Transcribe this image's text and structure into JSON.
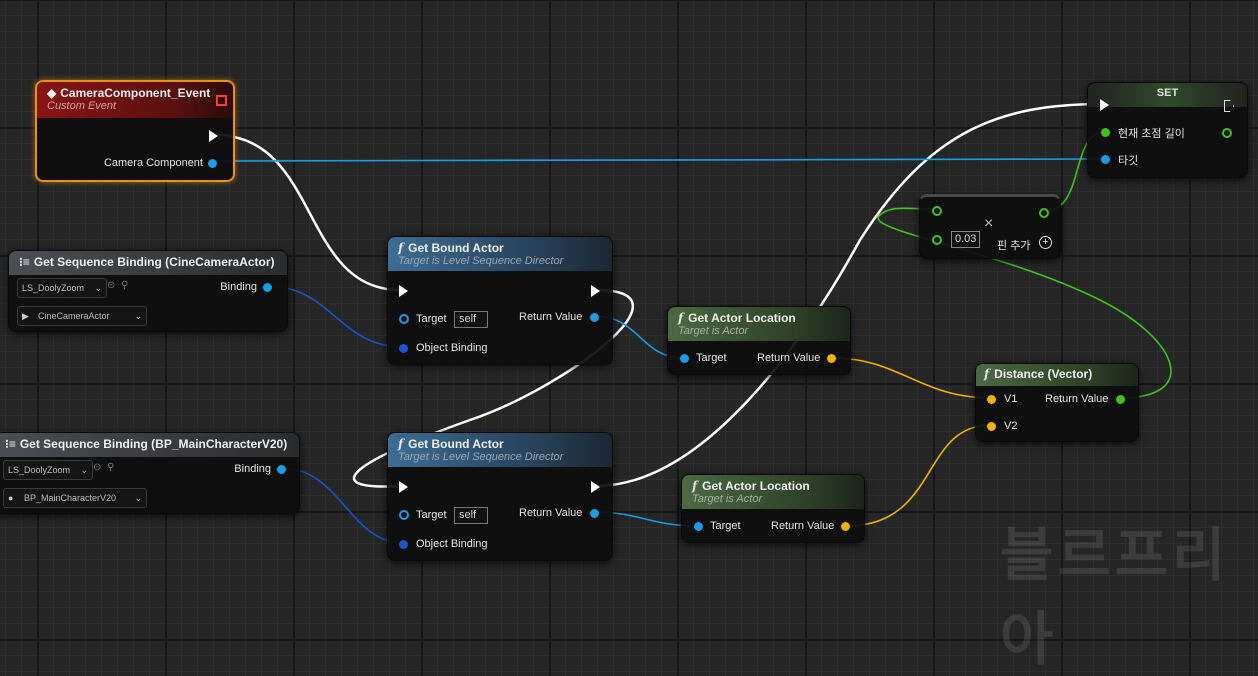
{
  "watermark": "블르프리아",
  "event_node": {
    "title": "CameraComponent_Event",
    "subtitle": "Custom Event",
    "pin_label": "Camera Component"
  },
  "binding_1": {
    "title": "Get Sequence Binding (CineCameraActor)",
    "sequence": "LS_DoolyZoom",
    "actor": "CineCameraActor",
    "pin_label": "Binding"
  },
  "binding_2": {
    "title": "Get Sequence Binding (BP_MainCharacterV20)",
    "sequence": "LS_DoolyZoom",
    "actor": "BP_MainCharacterV20",
    "pin_label": "Binding"
  },
  "bound_actor_1": {
    "title": "Get Bound Actor",
    "subtitle": "Target is Level Sequence Director",
    "target": "Target",
    "self": "self",
    "object_binding": "Object Binding",
    "return_value": "Return Value"
  },
  "bound_actor_2": {
    "title": "Get Bound Actor",
    "subtitle": "Target is Level Sequence Director",
    "target": "Target",
    "self": "self",
    "object_binding": "Object Binding",
    "return_value": "Return Value"
  },
  "actor_location_1": {
    "title": "Get Actor Location",
    "subtitle": "Target is Actor",
    "target": "Target",
    "return_value": "Return Value"
  },
  "actor_location_2": {
    "title": "Get Actor Location",
    "subtitle": "Target is Actor",
    "target": "Target",
    "return_value": "Return Value"
  },
  "distance_node": {
    "title": "Distance (Vector)",
    "v1": "V1",
    "v2": "V2",
    "return_value": "Return Value"
  },
  "set_node": {
    "title": "SET",
    "pin1": "현재 초점 길이",
    "pin2": "타깃"
  },
  "multiply_node": {
    "symbol": "×",
    "value": "0.03",
    "add_pin": "핀 추가"
  },
  "colors": {
    "exec": "#ffffff",
    "object": "#1b9ce6",
    "struct": "#f1b300",
    "float": "#3fc51a"
  }
}
